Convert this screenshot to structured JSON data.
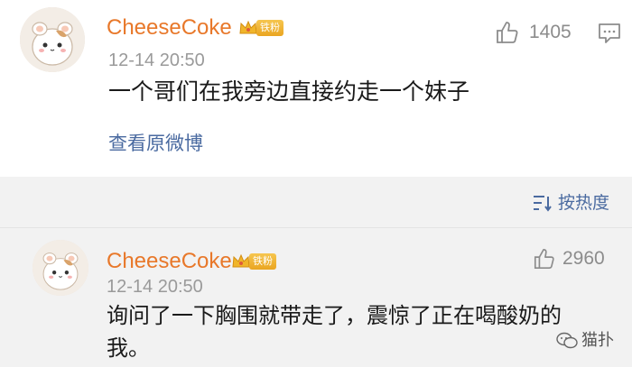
{
  "top_comment": {
    "username": "CheeseCoke",
    "fan_badge": "铁粉",
    "timestamp": "12-14 20:50",
    "likes": "1405",
    "text": "一个哥们在我旁边直接约走一个妹子",
    "view_original": "查看原微博"
  },
  "sort": {
    "label": "按热度"
  },
  "reply": {
    "username": "CheeseCoke",
    "fan_badge": "铁粉",
    "timestamp": "12-14 20:50",
    "likes": "2960",
    "text_line1": "询问了一下胸围就带走了，震惊了正在喝酸奶的",
    "text_line2": "我。"
  },
  "watermark": {
    "text": "猫扑",
    "icon": "wechat-icon"
  },
  "colors": {
    "username": "#e8782a",
    "link": "#4a6aa0",
    "muted": "#9a9a9a",
    "gray_bg": "#f2f2f2"
  }
}
